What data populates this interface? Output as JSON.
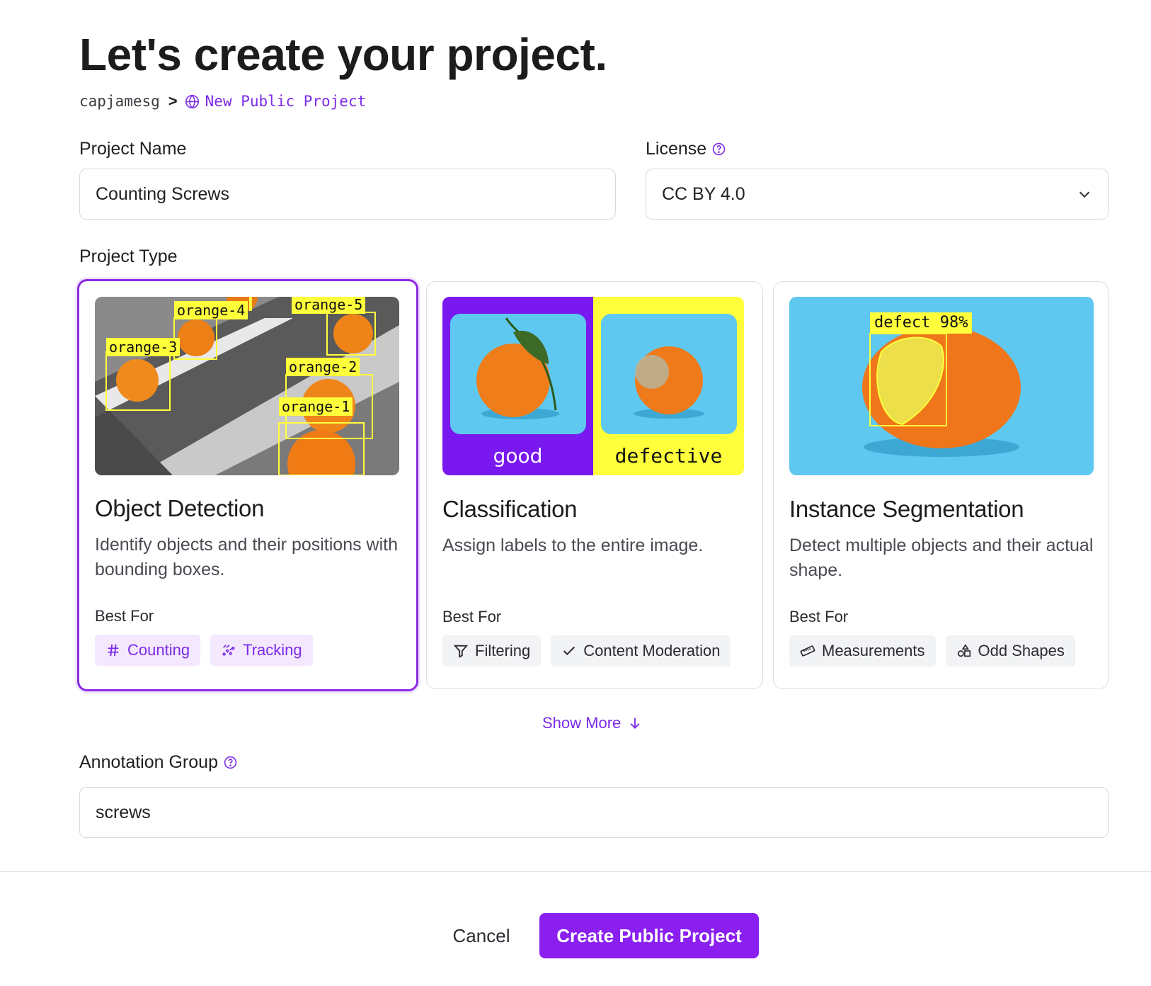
{
  "page": {
    "title": "Let's create your project."
  },
  "breadcrumb": {
    "user": "capjamesg",
    "separator": ">",
    "current": "New Public Project"
  },
  "form": {
    "project_name_label": "Project Name",
    "project_name_value": "Counting Screws",
    "license_label": "License",
    "license_value": "CC BY 4.0",
    "project_type_label": "Project Type",
    "annotation_group_label": "Annotation Group",
    "annotation_group_value": "screws"
  },
  "project_types": [
    {
      "title": "Object Detection",
      "description": "Identify objects and their positions with bounding boxes.",
      "best_for_label": "Best For",
      "tags": [
        {
          "label": "Counting",
          "icon": "hash-icon"
        },
        {
          "label": "Tracking",
          "icon": "tracking-icon"
        }
      ],
      "selected": true,
      "image_labels": [
        "orange-4",
        "orange-5",
        "orange-3",
        "orange-2",
        "orange-1"
      ]
    },
    {
      "title": "Classification",
      "description": "Assign labels to the entire image.",
      "best_for_label": "Best For",
      "tags": [
        {
          "label": "Filtering",
          "icon": "filter-icon"
        },
        {
          "label": "Content Moderation",
          "icon": "check-icon"
        }
      ],
      "selected": false,
      "image_labels": [
        "good",
        "defective"
      ]
    },
    {
      "title": "Instance Segmentation",
      "description": "Detect multiple objects and their actual shape.",
      "best_for_label": "Best For",
      "tags": [
        {
          "label": "Measurements",
          "icon": "ruler-icon"
        },
        {
          "label": "Odd Shapes",
          "icon": "shapes-icon"
        }
      ],
      "selected": false,
      "image_labels": [
        "defect 98%"
      ]
    }
  ],
  "show_more_label": "Show More",
  "footer": {
    "cancel_label": "Cancel",
    "create_label": "Create Public Project"
  },
  "colors": {
    "accent": "#8a1ff0",
    "accent_text": "#7c2ae8",
    "label_yellow": "#ffff3c",
    "thumb_blue": "#5fc8f0",
    "good_purple": "#7a18f0"
  }
}
